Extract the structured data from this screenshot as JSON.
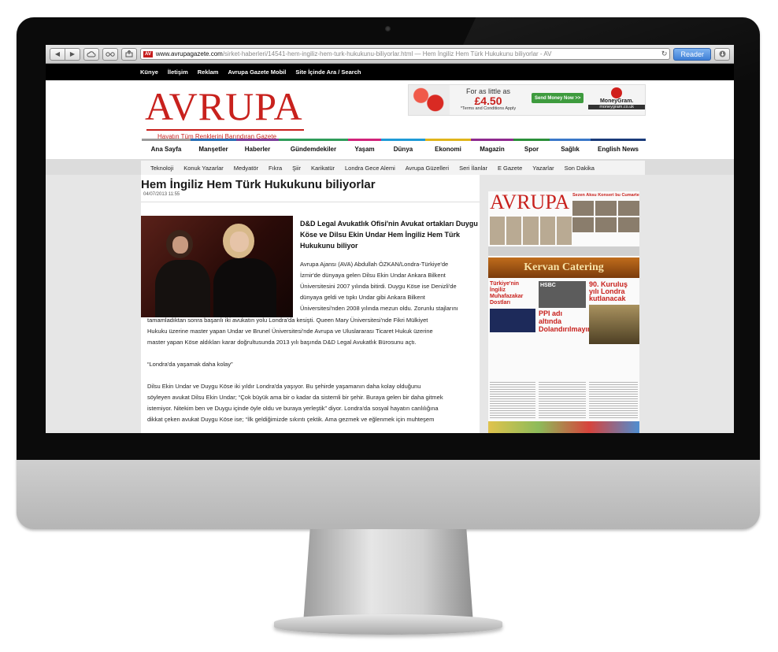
{
  "browser": {
    "back_icon": "◀",
    "forward_icon": "▶",
    "url_host": "www.avrupagazete.com",
    "url_rest": "/sirket-haberleri/14541-hem-ingiliz-hem-turk-hukukunu-biliyorlar.html — Hem İngiliz Hem Türk Hukukunu biliyorlar - AV",
    "favicon_text": "AV",
    "reader_label": "Reader",
    "reload_icon": "↻"
  },
  "topnav": [
    "Künye",
    "İletişim",
    "Reklam",
    "Avrupa Gazete Mobil",
    "Site İçinde Ara / Search"
  ],
  "header": {
    "logo": "AVRUPA",
    "tagline": "Hayatın Tüm Renklerini Barındıran Gazete"
  },
  "ad": {
    "line1": "For as little as",
    "price": "£4.50",
    "terms": "*Terms and Conditions Apply",
    "button": "Send Money Now >>",
    "brand": "MoneyGram.",
    "brand_url": "moneygram.co.uk"
  },
  "mainnav": [
    {
      "label": "Ana Sayfa",
      "color": "#9b9b9b"
    },
    {
      "label": "Manşetler",
      "color": "#2a6fb5"
    },
    {
      "label": "Haberler",
      "color": "#7a3f9b"
    },
    {
      "label": "Gündemdekiler",
      "color": "#2f9c5a"
    },
    {
      "label": "Yaşam",
      "color": "#d1237a"
    },
    {
      "label": "Dünya",
      "color": "#1f9bd7"
    },
    {
      "label": "Ekonomi",
      "color": "#e0b51b"
    },
    {
      "label": "Magazin",
      "color": "#8e2a8e"
    },
    {
      "label": "Spor",
      "color": "#2b8f3a"
    },
    {
      "label": "Sağlık",
      "color": "#3a78c9"
    },
    {
      "label": "English News",
      "color": "#1a3b7a"
    }
  ],
  "subnav": [
    "Teknoloji",
    "Konuk Yazarlar",
    "Medyatör",
    "Fıkra",
    "Şiir",
    "Karikatür",
    "Londra Gece Alemi",
    "Avrupa Güzelleri",
    "Seri İlanlar",
    "E Gazete",
    "Yazarlar",
    "Son Dakika"
  ],
  "article": {
    "title": "Hem İngiliz Hem Türk Hukukunu biliyorlar",
    "date": "04/07/2013 11:55",
    "lead": "D&D Legal Avukatlık Ofisi'nin Avukat ortakları Duygu Köse ve Dilsu Ekin Undar Hem İngiliz Hem Türk Hukukunu biliyor",
    "side_lines": [
      "Avrupa Ajansı (AVA) Abdullah ÖZKAN/Londra-Türkiye'de",
      "İzmir'de dünyaya gelen Dilsu Ekin Undar Ankara Bilkent",
      "Üniversitesini 2007 yılında bitirdi. Duygu Köse ise Denizli'de",
      "dünyaya geldi ve tıpkı Undar gibi Ankara Bilkent",
      "Üniversitesi'nden 2008 yılında mezun oldu. Zorunlu stajlarını"
    ],
    "full_lines_1": [
      "tamamladıktan sonra başarılı iki avukatın yolu Londra'da kesişti. Queen Mary Üniversitesi'nde Fikri Mülkiyet",
      "Hukuku üzerine master yapan Undar ve Brunel Üniversitesi'nde Avrupa ve Uluslararası Ticaret Hukuk üzerine",
      "master yapan Köse aldıkları karar doğrultusunda 2013 yılı başında D&D Legal Avukatlık Bürosunu açtı."
    ],
    "quote": "“Londra'da yaşamak daha kolay”",
    "full_lines_2": [
      "Dilsu Ekin Undar ve Duygu Köse iki yıldır Londra'da yaşıyor. Bu şehirde yaşamanın daha kolay olduğunu",
      "söyleyen avukat Dilsu Ekin Undar; “Çok büyük ama bir o kadar da sistemli bir şehir. Buraya gelen bir daha gitmek",
      "istemiyor. Nitekim ben ve Duygu içinde öyle oldu ve buraya yerleştik” diyor. Londra'da sosyal hayatın canlılığına",
      "dikkat çeken avukat Duygu Köse ise; “İlk geldiğimizde sıkıntı çektik. Ama gezmek ve eğlenmek için muhteşem"
    ]
  },
  "newspaper": {
    "logo": "AVRUPA",
    "band": "Sezen Aksu Konseri bu Cumartesi",
    "kervan": "Kervan Catering",
    "col1_title": "Türkiye'nin İngiliz Muhafazakar Dostları",
    "col2_hsbc": "HSBC",
    "col2_title": "PPI adı altında Dolandırılmayın",
    "col3_title": "90. Kuruluş yılı Londra kutlanacak"
  }
}
